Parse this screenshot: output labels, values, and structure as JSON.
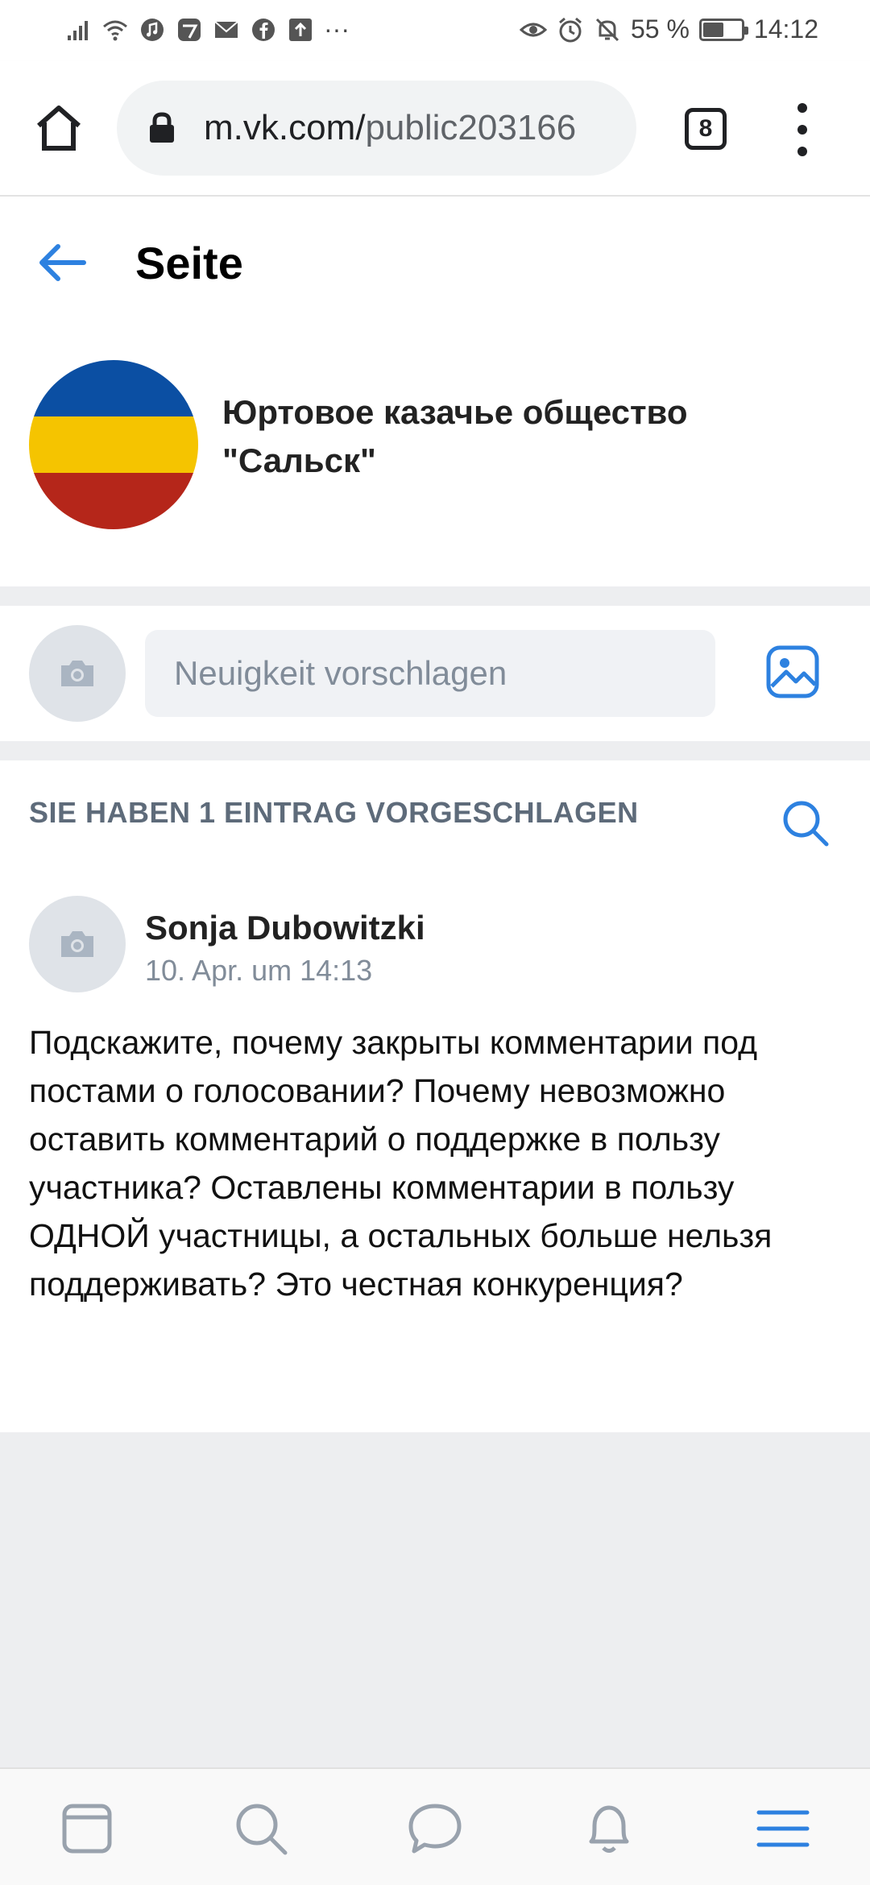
{
  "status_bar": {
    "battery_text": "55 %",
    "battery_level_percent": 55,
    "time": "14:12",
    "more_indicator": "···",
    "icons": [
      "signal-icon",
      "wifi-icon",
      "music-icon",
      "app-icon",
      "mail-icon",
      "facebook-icon",
      "upload-icon",
      "eye-icon",
      "alarm-icon",
      "mute-icon",
      "battery-icon"
    ]
  },
  "browser": {
    "url_host": "m.vk.com/",
    "url_path": "public203166",
    "tab_count": "8"
  },
  "header": {
    "title": "Seite"
  },
  "community": {
    "name": "Юртовое казачье общество \"Сальск\"",
    "flag_colors": [
      "#0b4fa3",
      "#f5c400",
      "#b5261a"
    ]
  },
  "suggest": {
    "placeholder": "Neuigkeit vorschlagen"
  },
  "posts": {
    "section_title": "SIE HABEN 1 EINTRAG VORGESCHLAGEN",
    "items": [
      {
        "author": "Sonja Dubowitzki",
        "date": "10. Apr. um 14:13",
        "text": "Подскажите, почему закрыты комментарии под постами о голосовании? Почему невозможно оставить комментарий о поддержке в пользу участника? Оставлены комментарии в пользу ОДНОЙ участницы, а остальных больше нельзя поддерживать? Это честная конкуренция?"
      }
    ]
  },
  "bottom_nav": {
    "items": [
      "feed-icon",
      "search-icon",
      "messages-icon",
      "notifications-icon",
      "menu-icon"
    ],
    "active": "menu-icon"
  },
  "colors": {
    "accent": "#2d81e0",
    "background": "#edeef0",
    "secondary_text": "#818c99"
  }
}
